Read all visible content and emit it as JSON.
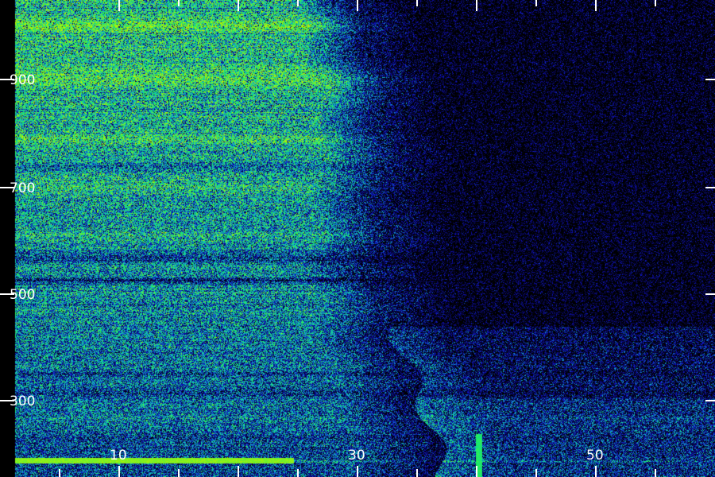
{
  "spectrogram": {
    "colors": {
      "background": "#000000",
      "low": "#1010c8",
      "mid": "#12b9c8",
      "high": "#18f060",
      "peak": "#b8f000",
      "ticks": "#ffffff"
    },
    "x_axis": {
      "tick_labels": [
        "10",
        "30",
        "50"
      ]
    },
    "y_axis": {
      "tick_labels": [
        "900",
        "700",
        "500",
        "300"
      ]
    }
  }
}
